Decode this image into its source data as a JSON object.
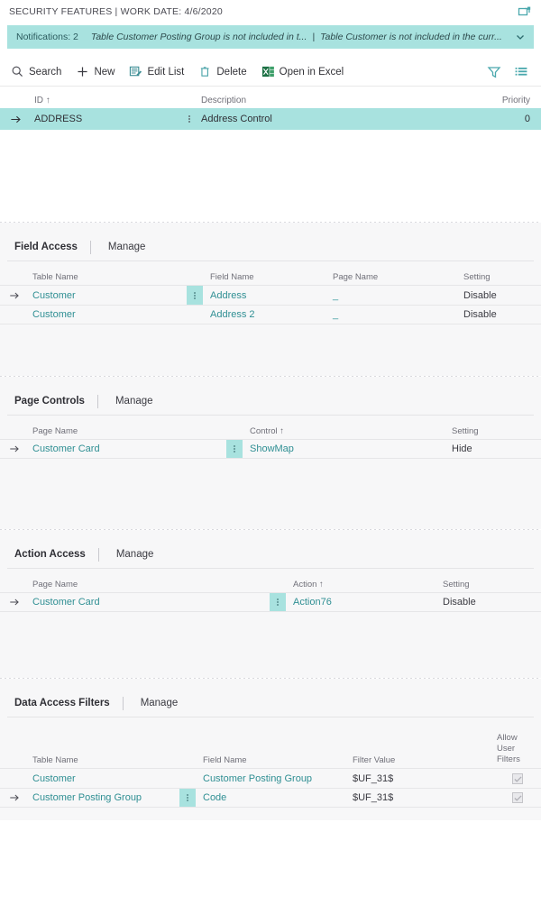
{
  "titlebar": {
    "text": "SECURITY FEATURES | WORK DATE: 4/6/2020",
    "popout_icon": "open-in-new-window-icon"
  },
  "notifications": {
    "count_label": "Notifications: 2",
    "messages": [
      "Table Customer Posting Group is not included in t...",
      "Table Customer is not included in the curr..."
    ],
    "separator": "|",
    "expand_icon": "chevron-down-icon",
    "background": "#a8e2df"
  },
  "commandbar": {
    "items": [
      {
        "label": "Search",
        "icon": "search-icon"
      },
      {
        "label": "New",
        "icon": "plus-icon"
      },
      {
        "label": "Edit List",
        "icon": "edit-list-icon"
      },
      {
        "label": "Delete",
        "icon": "trash-icon"
      },
      {
        "label": "Open in Excel",
        "icon": "excel-icon"
      }
    ],
    "right_icons": [
      {
        "name": "filter-icon"
      },
      {
        "name": "list-view-icon"
      }
    ]
  },
  "main_grid": {
    "columns": [
      "ID ↑",
      "Description",
      "Priority"
    ],
    "rows": [
      {
        "id": "ADDRESS",
        "description": "Address Control",
        "priority": "0",
        "selected": true
      }
    ]
  },
  "parts": [
    {
      "title": "Field Access",
      "manage": "Manage",
      "columns": [
        "Table Name",
        "Field Name",
        "Page Name",
        "Setting"
      ],
      "rows": [
        {
          "table": "Customer",
          "field": "Address",
          "page": "_",
          "setting": "Disable",
          "selected": true
        },
        {
          "table": "Customer",
          "field": "Address 2",
          "page": "_",
          "setting": "Disable",
          "selected": false
        }
      ]
    },
    {
      "title": "Page Controls",
      "manage": "Manage",
      "columns": [
        "Page Name",
        "Control ↑",
        "Setting"
      ],
      "rows": [
        {
          "page": "Customer Card",
          "control": "ShowMap",
          "setting": "Hide",
          "selected": true
        }
      ]
    },
    {
      "title": "Action Access",
      "manage": "Manage",
      "columns": [
        "Page Name",
        "Action ↑",
        "Setting"
      ],
      "rows": [
        {
          "page": "Customer Card",
          "action": "Action76",
          "setting": "Disable",
          "selected": true
        }
      ]
    },
    {
      "title": "Data Access Filters",
      "manage": "Manage",
      "columns": [
        "Table Name",
        "Field Name",
        "Filter Value",
        "Allow User Filters"
      ],
      "allow_header_lines": [
        "Allow",
        "User",
        "Filters"
      ],
      "rows": [
        {
          "table": "Customer",
          "field": "Customer Posting Group",
          "value": "$UF_31$",
          "allow": true,
          "selected": false
        },
        {
          "table": "Customer Posting Group",
          "field": "Code",
          "value": "$UF_31$",
          "allow": true,
          "selected": true
        }
      ]
    }
  ],
  "colors": {
    "accent_highlight": "#a8e2df",
    "link": "#2f8f93",
    "text": "#2f2f35",
    "muted": "#6f6f78",
    "panel_bg": "#f7f7f8"
  }
}
